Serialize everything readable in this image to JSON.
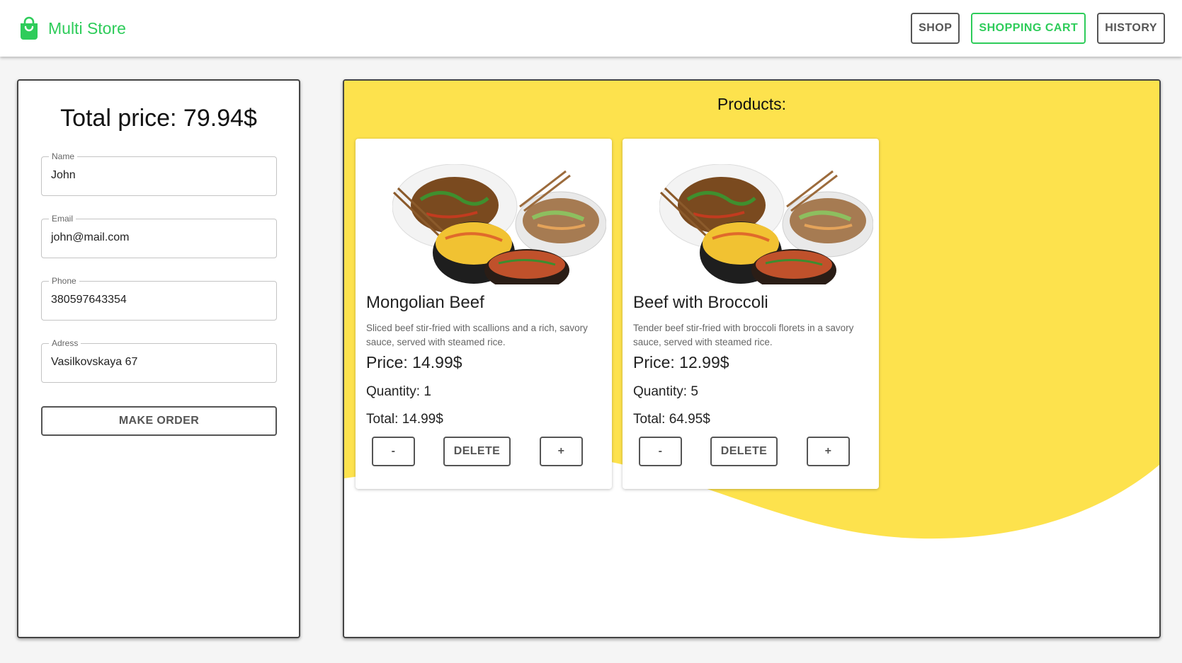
{
  "header": {
    "brand": "Multi Store",
    "brand_color": "#2ecc5a",
    "logo_icon": "shopping-bag-icon",
    "nav": [
      {
        "label": "SHOP",
        "active": false
      },
      {
        "label": "SHOPPING CART",
        "active": true
      },
      {
        "label": "HISTORY",
        "active": false
      }
    ]
  },
  "order": {
    "total_label": "Total price: 79.94$",
    "fields": [
      {
        "label": "Name",
        "value": "John"
      },
      {
        "label": "Email",
        "value": "john@mail.com"
      },
      {
        "label": "Phone",
        "value": "380597643354"
      },
      {
        "label": "Adress",
        "value": "Vasilkovskaya 67"
      }
    ],
    "submit_label": "MAKE ORDER"
  },
  "products": {
    "title": "Products:",
    "accent_color": "#fde24d",
    "items": [
      {
        "title": "Mongolian Beef",
        "description": "Sliced beef stir-fried with scallions and a rich, savory sauce, served with steamed rice.",
        "price": "Price: 14.99$",
        "quantity": "Quantity: 1",
        "total": "Total: 14.99$",
        "minus_label": "-",
        "delete_label": "DELETE",
        "plus_label": "+"
      },
      {
        "title": "Beef with Broccoli",
        "description": "Tender beef stir-fried with broccoli florets in a savory sauce, served with steamed rice.",
        "price": "Price: 12.99$",
        "quantity": "Quantity: 5",
        "total": "Total: 64.95$",
        "minus_label": "-",
        "delete_label": "DELETE",
        "plus_label": "+"
      }
    ]
  }
}
